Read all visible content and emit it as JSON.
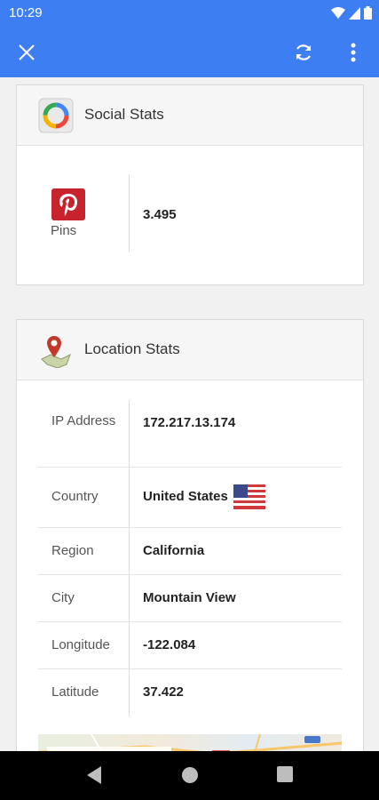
{
  "status_bar": {
    "time": "10:29"
  },
  "app_bar": {
    "icons": [
      "close-icon",
      "refresh-icon",
      "more-vert-icon"
    ],
    "accent": "#3d7ef3"
  },
  "social_stats": {
    "title": "Social Stats",
    "pins_label": "Pins",
    "pins_value": "3.495"
  },
  "location_stats": {
    "title": "Location Stats",
    "rows": [
      {
        "label": "IP Address",
        "value": "172.217.13.174"
      },
      {
        "label": "Country",
        "value": "United States",
        "flag": "us-flag-icon"
      },
      {
        "label": "Region",
        "value": "California"
      },
      {
        "label": "City",
        "value": "Mountain View"
      },
      {
        "label": "Longitude",
        "value": "-122.084"
      },
      {
        "label": "Latitude",
        "value": "37.422"
      }
    ]
  },
  "nav_bar": {
    "icons": [
      "back-icon",
      "home-icon",
      "recents-icon"
    ]
  }
}
